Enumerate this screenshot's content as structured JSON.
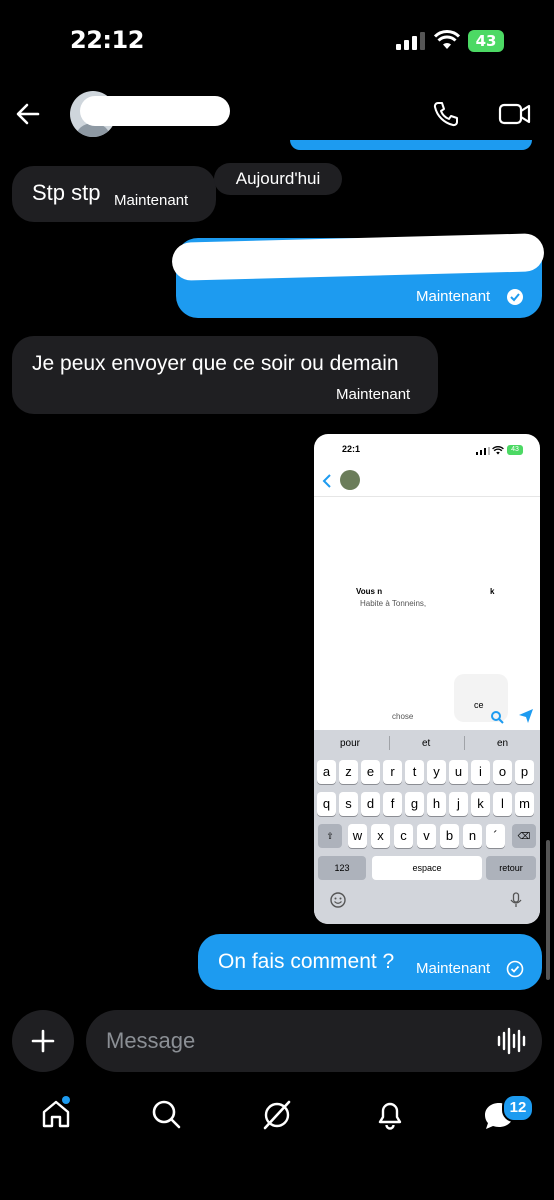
{
  "status_bar": {
    "time": "22:12",
    "battery": "43"
  },
  "header": {},
  "messages": [
    {
      "text": "Stp stp",
      "time": "Maintenant"
    },
    {
      "time": "Maintenant"
    },
    {
      "text": "Je peux envoyer que ce soir ou demain",
      "time": "Maintenant"
    },
    {
      "text": "On fais comment ?",
      "time": "Maintenant"
    }
  ],
  "date_separator": "Aujourd'hui",
  "attachment": {
    "time": "22:1",
    "battery": "43",
    "profile_line1": "Vous n",
    "profile_line1_end": "k",
    "profile_line2": "Habite à Tonneins, ",
    "input_suffix": "ce",
    "input_text": "chose",
    "suggestions": [
      "pour",
      "et",
      "en"
    ],
    "row1": [
      "a",
      "z",
      "e",
      "r",
      "t",
      "y",
      "u",
      "i",
      "o",
      "p"
    ],
    "row2": [
      "q",
      "s",
      "d",
      "f",
      "g",
      "h",
      "j",
      "k",
      "l",
      "m"
    ],
    "row3": [
      "w",
      "x",
      "c",
      "v",
      "b",
      "n",
      "´"
    ],
    "numbers_key": "123",
    "space_key": "espace",
    "return_key": "retour"
  },
  "composer": {
    "placeholder": "Message"
  },
  "tab_bar": {
    "badge_count": "12"
  },
  "colors": {
    "accent": "#1d9bf0",
    "bubble_incoming": "#1f1f22",
    "background": "#000000"
  }
}
